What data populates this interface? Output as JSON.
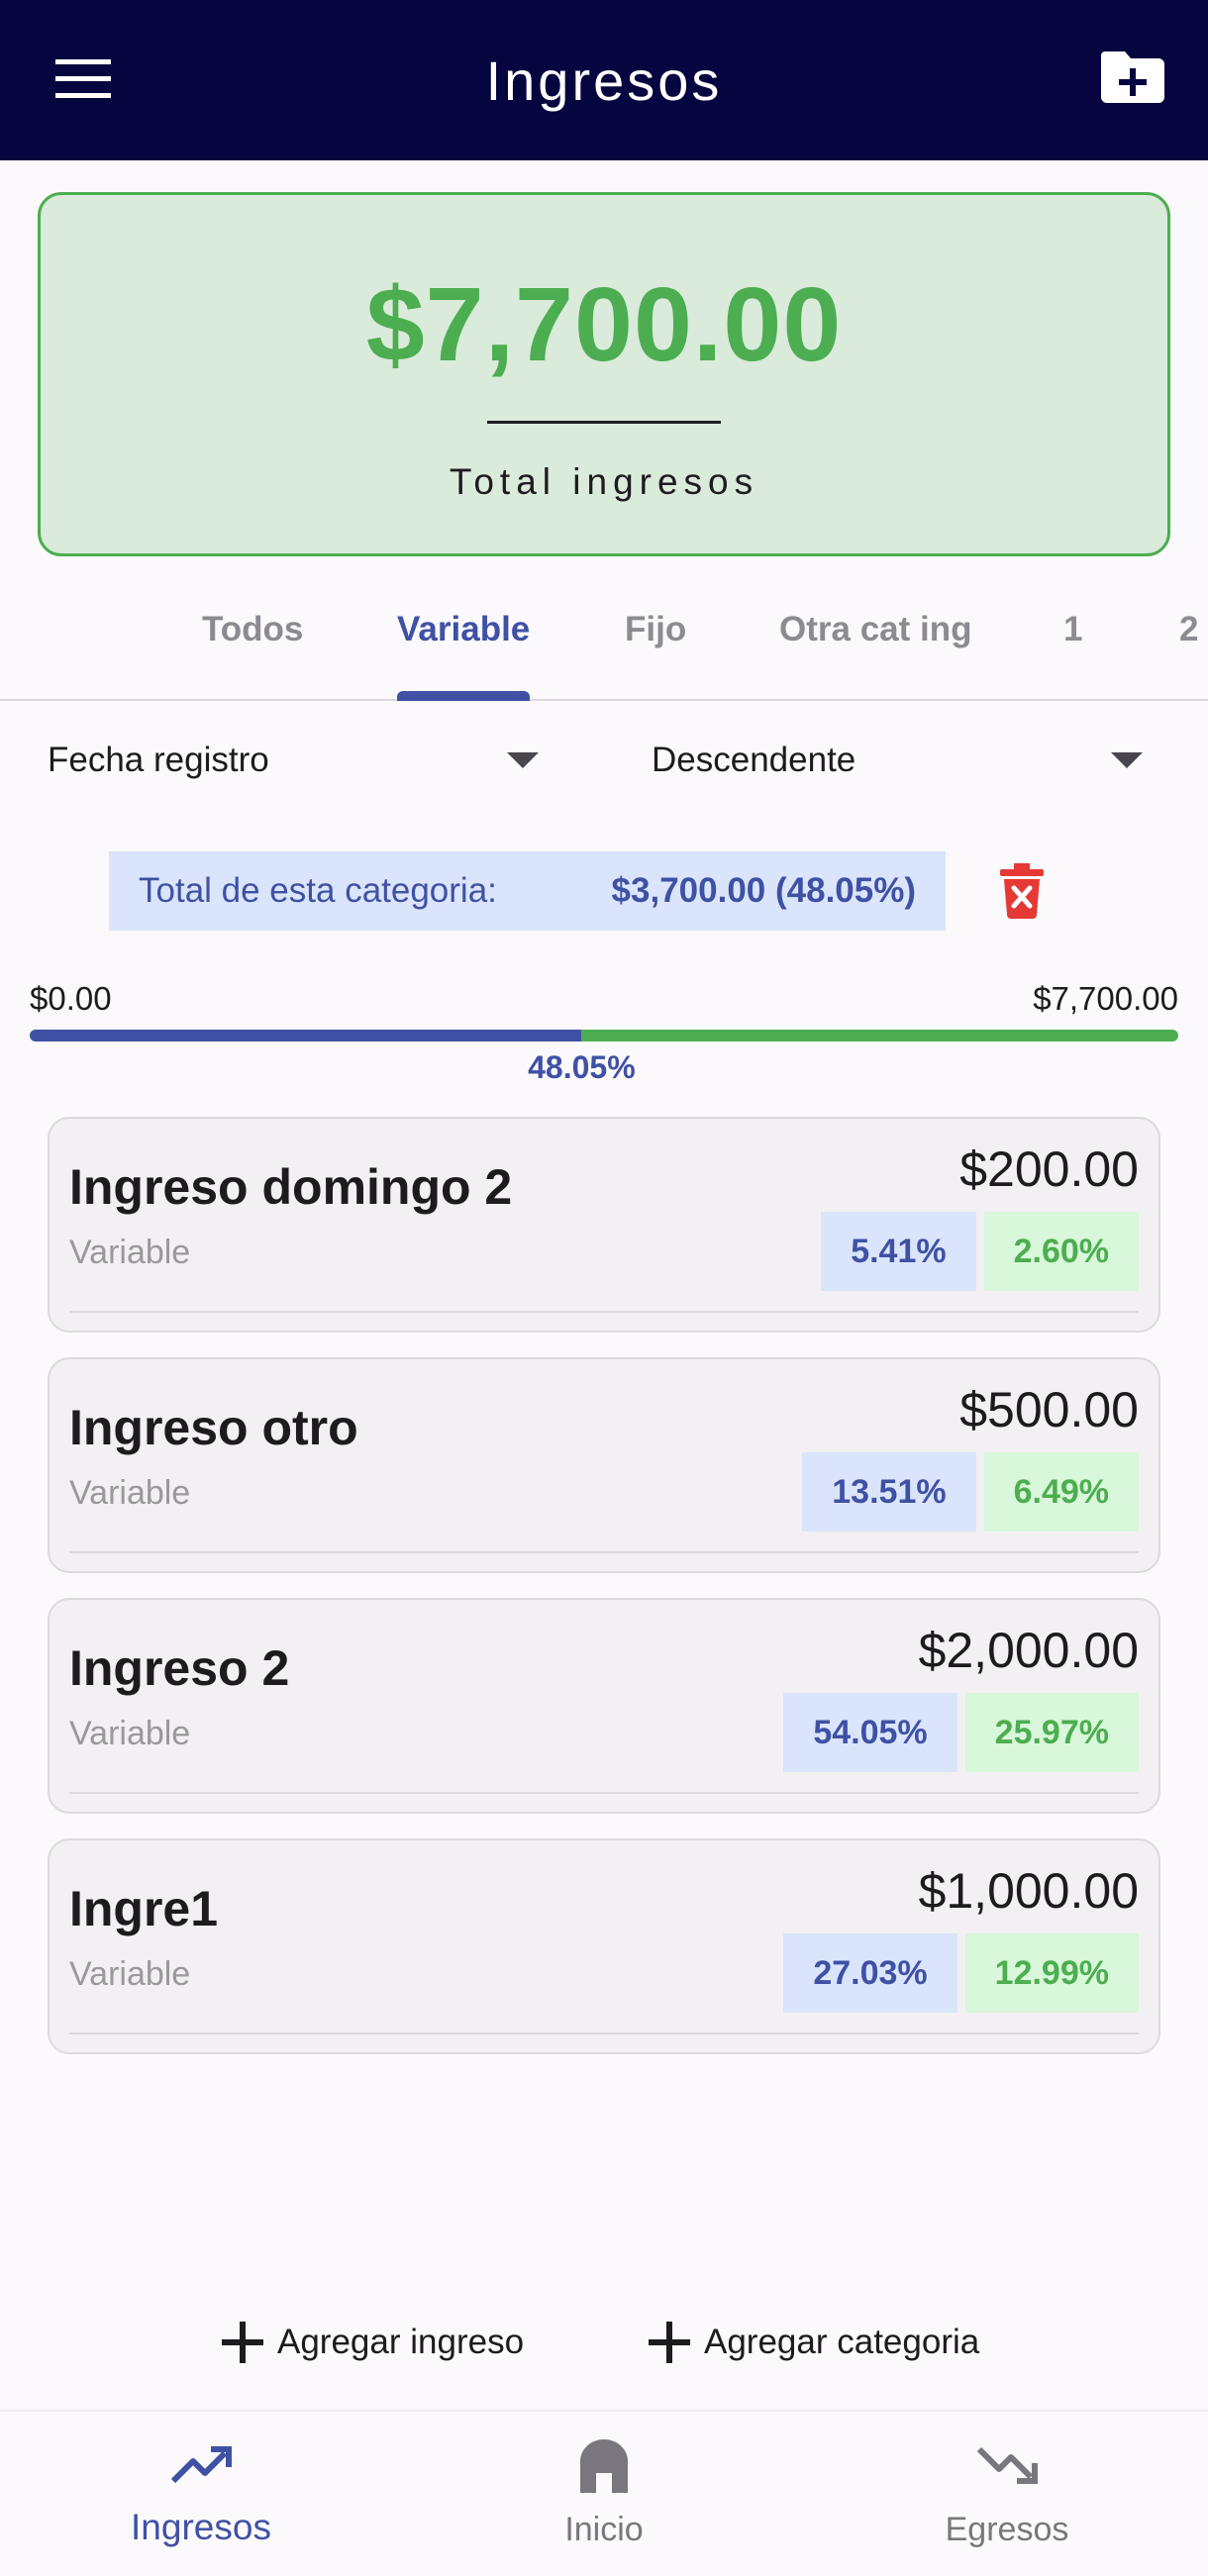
{
  "appbar": {
    "title": "Ingresos",
    "menu_icon": "menu-icon",
    "action_icon": "folder-add-icon"
  },
  "summary": {
    "total": "$7,700.00",
    "caption": "Total ingresos"
  },
  "tabs": [
    {
      "label": "Todos",
      "active": false
    },
    {
      "label": "Variable",
      "active": true
    },
    {
      "label": "Fijo",
      "active": false
    },
    {
      "label": "Otra cat ing",
      "active": false
    },
    {
      "label": "1",
      "active": false
    },
    {
      "label": "2",
      "active": false
    }
  ],
  "sort": {
    "field": "Fecha registro",
    "order": "Descendente"
  },
  "category_total": {
    "label": "Total de esta categoria:",
    "value": "$3,700.00 (48.05%)"
  },
  "progress": {
    "min": "$0.00",
    "max": "$7,700.00",
    "fraction": 0.4805,
    "label": "48.05%"
  },
  "incomes": [
    {
      "name": "Ingreso domingo 2",
      "category": "Variable",
      "amount": "$200.00",
      "pct_category": "5.41%",
      "pct_total": "2.60%"
    },
    {
      "name": "Ingreso otro",
      "category": "Variable",
      "amount": "$500.00",
      "pct_category": "13.51%",
      "pct_total": "6.49%"
    },
    {
      "name": "Ingreso 2",
      "category": "Variable",
      "amount": "$2,000.00",
      "pct_category": "54.05%",
      "pct_total": "25.97%"
    },
    {
      "name": "Ingre1",
      "category": "Variable",
      "amount": "$1,000.00",
      "pct_category": "27.03%",
      "pct_total": "12.99%"
    }
  ],
  "actions": {
    "add_income": "Agregar ingreso",
    "add_category": "Agregar categoria"
  },
  "bottom_nav": [
    {
      "label": "Ingresos",
      "icon": "trending-up-icon",
      "active": true
    },
    {
      "label": "Inicio",
      "icon": "home-icon",
      "active": false
    },
    {
      "label": "Egresos",
      "icon": "trending-down-icon",
      "active": false
    }
  ],
  "colors": {
    "appbar": "#06053f",
    "primary": "#3f51a5",
    "green": "#4cae50",
    "delete": "#e53935"
  }
}
